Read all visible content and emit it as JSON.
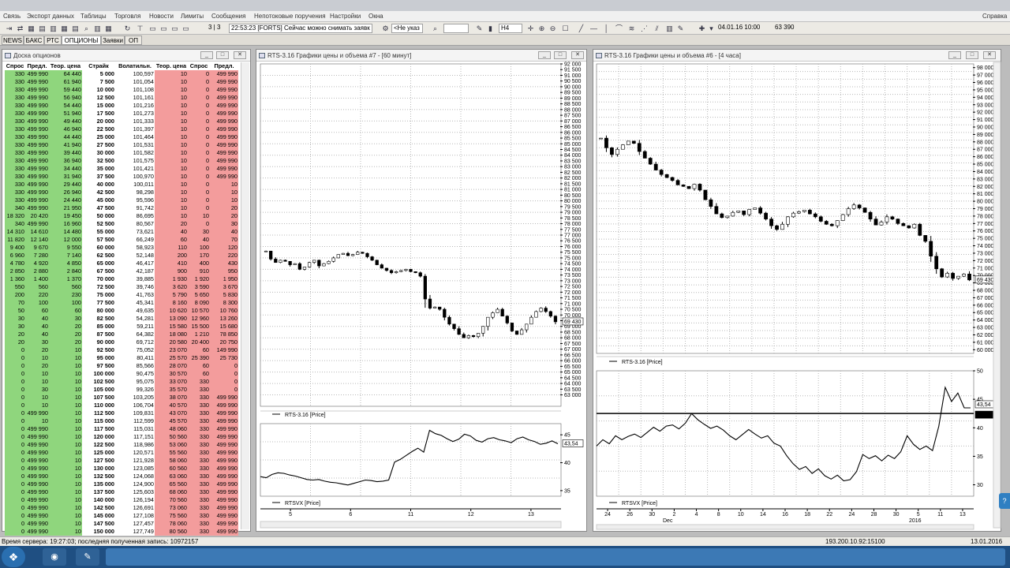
{
  "app": {
    "menu": [
      "Связь",
      "Экспорт данных",
      "Таблицы",
      "Торговля",
      "Новости",
      "Лимиты",
      "Сообщения",
      "Непотоковые поручения",
      "Настройки",
      "Окна"
    ],
    "help_label": "Справка"
  },
  "toolbar": {
    "page_counter": "3 | 3",
    "message": "22:53:23 [FORTS] Сейчас можно снимать заявк",
    "account_select": "<Не указ",
    "search_value": "",
    "interval_select": "H4",
    "date_field": "04.01.16 10:00",
    "price_field": "63 390"
  },
  "tabs": [
    {
      "label": "NEWS",
      "active": false
    },
    {
      "label": "БАКС",
      "active": false
    },
    {
      "label": "РТС",
      "active": false
    },
    {
      "label": "ОПЦИОНЫ",
      "active": true
    },
    {
      "label": "Заявки",
      "active": false
    },
    {
      "label": "ОП",
      "active": false
    }
  ],
  "options_window": {
    "title": "Доска опционов",
    "columns": [
      "Спрос",
      "Предл.",
      "Теор. цена",
      "Страйк",
      "Волатильн.",
      "Теор. цена",
      "Спрос",
      "Предл."
    ],
    "rows": [
      [
        "330",
        "499 990",
        "64 440",
        "5 000",
        "100,597",
        "10",
        "0",
        "499 990"
      ],
      [
        "330",
        "499 990",
        "61 940",
        "7 500",
        "101,054",
        "10",
        "0",
        "499 990"
      ],
      [
        "330",
        "499 990",
        "59 440",
        "10 000",
        "101,108",
        "10",
        "0",
        "499 990"
      ],
      [
        "330",
        "499 990",
        "56 940",
        "12 500",
        "101,161",
        "10",
        "0",
        "499 990"
      ],
      [
        "330",
        "499 990",
        "54 440",
        "15 000",
        "101,216",
        "10",
        "0",
        "499 990"
      ],
      [
        "330",
        "499 990",
        "51 940",
        "17 500",
        "101,273",
        "10",
        "0",
        "499 990"
      ],
      [
        "330",
        "499 990",
        "49 440",
        "20 000",
        "101,333",
        "10",
        "0",
        "499 990"
      ],
      [
        "330",
        "499 990",
        "46 940",
        "22 500",
        "101,397",
        "10",
        "0",
        "499 990"
      ],
      [
        "330",
        "499 990",
        "44 440",
        "25 000",
        "101,464",
        "10",
        "0",
        "499 990"
      ],
      [
        "330",
        "499 990",
        "41 940",
        "27 500",
        "101,531",
        "10",
        "0",
        "499 990"
      ],
      [
        "330",
        "499 990",
        "39 440",
        "30 000",
        "101,582",
        "10",
        "0",
        "499 990"
      ],
      [
        "330",
        "499 990",
        "36 940",
        "32 500",
        "101,575",
        "10",
        "0",
        "499 990"
      ],
      [
        "330",
        "499 990",
        "34 440",
        "35 000",
        "101,421",
        "10",
        "0",
        "499 990"
      ],
      [
        "330",
        "499 990",
        "31 940",
        "37 500",
        "100,970",
        "10",
        "0",
        "499 990"
      ],
      [
        "330",
        "499 990",
        "29 440",
        "40 000",
        "100,011",
        "10",
        "0",
        "10"
      ],
      [
        "330",
        "499 990",
        "26 940",
        "42 500",
        "98,298",
        "10",
        "0",
        "10"
      ],
      [
        "330",
        "499 990",
        "24 440",
        "45 000",
        "95,596",
        "10",
        "0",
        "10"
      ],
      [
        "340",
        "499 990",
        "21 950",
        "47 500",
        "91,742",
        "10",
        "0",
        "20"
      ],
      [
        "18 320",
        "20 420",
        "19 450",
        "50 000",
        "86,695",
        "10",
        "10",
        "20"
      ],
      [
        "340",
        "499 990",
        "16 960",
        "52 500",
        "80,567",
        "20",
        "0",
        "30"
      ],
      [
        "14 310",
        "14 610",
        "14 480",
        "55 000",
        "73,621",
        "40",
        "30",
        "40"
      ],
      [
        "11 820",
        "12 140",
        "12 000",
        "57 500",
        "66,249",
        "60",
        "40",
        "70"
      ],
      [
        "9 400",
        "9 670",
        "9 550",
        "60 000",
        "58,923",
        "110",
        "100",
        "120"
      ],
      [
        "6 960",
        "7 280",
        "7 140",
        "62 500",
        "52,148",
        "200",
        "170",
        "220"
      ],
      [
        "4 780",
        "4 920",
        "4 850",
        "65 000",
        "46,417",
        "410",
        "400",
        "430"
      ],
      [
        "2 850",
        "2 880",
        "2 840",
        "67 500",
        "42,187",
        "900",
        "910",
        "950"
      ],
      [
        "1 360",
        "1 400",
        "1 370",
        "70 000",
        "39,885",
        "1 930",
        "1 920",
        "1 950"
      ],
      [
        "550",
        "560",
        "560",
        "72 500",
        "39,746",
        "3 620",
        "3 590",
        "3 670"
      ],
      [
        "200",
        "220",
        "230",
        "75 000",
        "41,763",
        "5 790",
        "5 650",
        "5 830"
      ],
      [
        "70",
        "100",
        "100",
        "77 500",
        "45,341",
        "8 160",
        "8 090",
        "8 300"
      ],
      [
        "50",
        "60",
        "60",
        "80 000",
        "49,635",
        "10 620",
        "10 570",
        "10 760"
      ],
      [
        "30",
        "40",
        "30",
        "82 500",
        "54,281",
        "13 090",
        "12 960",
        "13 260"
      ],
      [
        "30",
        "40",
        "20",
        "85 000",
        "59,211",
        "15 580",
        "15 500",
        "15 680"
      ],
      [
        "20",
        "40",
        "20",
        "87 500",
        "64,382",
        "18 080",
        "1 210",
        "78 850"
      ],
      [
        "20",
        "30",
        "20",
        "90 000",
        "69,712",
        "20 580",
        "20 400",
        "20 750"
      ],
      [
        "0",
        "20",
        "10",
        "92 500",
        "75,052",
        "23 070",
        "60",
        "149 990"
      ],
      [
        "0",
        "10",
        "10",
        "95 000",
        "80,411",
        "25 570",
        "25 390",
        "25 730"
      ],
      [
        "0",
        "20",
        "10",
        "97 500",
        "85,566",
        "28 070",
        "60",
        "0"
      ],
      [
        "0",
        "10",
        "10",
        "100 000",
        "90,475",
        "30 570",
        "60",
        "0"
      ],
      [
        "0",
        "10",
        "10",
        "102 500",
        "95,075",
        "33 070",
        "330",
        "0"
      ],
      [
        "0",
        "30",
        "10",
        "105 000",
        "99,326",
        "35 570",
        "330",
        "0"
      ],
      [
        "0",
        "10",
        "10",
        "107 500",
        "103,205",
        "38 070",
        "330",
        "499 990"
      ],
      [
        "0",
        "10",
        "10",
        "110 000",
        "106,704",
        "40 570",
        "330",
        "499 990"
      ],
      [
        "0",
        "499 990",
        "10",
        "112 500",
        "109,831",
        "43 070",
        "330",
        "499 990"
      ],
      [
        "0",
        "10",
        "10",
        "115 000",
        "112,599",
        "45 570",
        "330",
        "499 990"
      ],
      [
        "0",
        "499 990",
        "10",
        "117 500",
        "115,031",
        "48 060",
        "330",
        "499 990"
      ],
      [
        "0",
        "499 990",
        "10",
        "120 000",
        "117,151",
        "50 560",
        "330",
        "499 990"
      ],
      [
        "0",
        "499 990",
        "10",
        "122 500",
        "118,986",
        "53 060",
        "330",
        "499 990"
      ],
      [
        "0",
        "499 990",
        "10",
        "125 000",
        "120,571",
        "55 560",
        "330",
        "499 990"
      ],
      [
        "0",
        "499 990",
        "10",
        "127 500",
        "121,928",
        "58 060",
        "330",
        "499 990"
      ],
      [
        "0",
        "499 990",
        "10",
        "130 000",
        "123,085",
        "60 560",
        "330",
        "499 990"
      ],
      [
        "0",
        "499 990",
        "10",
        "132 500",
        "124,068",
        "63 060",
        "330",
        "499 990"
      ],
      [
        "0",
        "499 990",
        "10",
        "135 000",
        "124,900",
        "65 560",
        "330",
        "499 990"
      ],
      [
        "0",
        "499 990",
        "10",
        "137 500",
        "125,603",
        "68 060",
        "330",
        "499 990"
      ],
      [
        "0",
        "499 990",
        "10",
        "140 000",
        "126,194",
        "70 560",
        "330",
        "499 990"
      ],
      [
        "0",
        "499 990",
        "10",
        "142 500",
        "126,691",
        "73 060",
        "330",
        "499 990"
      ],
      [
        "0",
        "499 990",
        "10",
        "145 000",
        "127,108",
        "75 560",
        "330",
        "499 990"
      ],
      [
        "0",
        "499 990",
        "10",
        "147 500",
        "127,457",
        "78 060",
        "330",
        "499 990"
      ],
      [
        "0",
        "499 990",
        "10",
        "150 000",
        "127,749",
        "80 560",
        "330",
        "499 990"
      ]
    ]
  },
  "chart_data": [
    {
      "type": "candlestick",
      "title": "RTS-3.16 Графики цены и объема #7 - [60 минут]",
      "legend": "RTS-3.16 [Price]",
      "ylim": [
        62000,
        92000
      ],
      "yticks": [
        "92 000",
        "91 500",
        "91 000",
        "90 500",
        "90 000",
        "89 500",
        "89 000",
        "88 500",
        "88 000",
        "87 500",
        "87 000",
        "86 500",
        "86 000",
        "85 500",
        "85 000",
        "84 500",
        "84 000",
        "83 500",
        "83 000",
        "82 500",
        "82 000",
        "81 500",
        "81 000",
        "80 500",
        "80 000",
        "79 500",
        "79 000",
        "78 500",
        "78 000",
        "77 500",
        "77 000",
        "76 500",
        "76 000",
        "75 500",
        "75 000",
        "74 500",
        "74 000",
        "73 500",
        "73 000",
        "72 500",
        "72 000",
        "71 500",
        "71 000",
        "70 500",
        "70 000",
        "69 500",
        "69 000",
        "68 500",
        "68 000",
        "67 500",
        "67 000",
        "66 500",
        "66 000",
        "65 500",
        "65 000",
        "64 500",
        "64 000",
        "63 500",
        "63 000"
      ],
      "last_price_label": "69 430",
      "x_ticks": [
        "5",
        "6",
        "11",
        "12",
        "13"
      ],
      "values": [
        75600,
        74900,
        74600,
        74800,
        74700,
        74400,
        74500,
        74000,
        74200,
        74600,
        74800,
        74300,
        74500,
        74700,
        75000,
        75300,
        75400,
        75200,
        75300,
        75500,
        75400,
        75100,
        74800,
        74400,
        74100,
        73900,
        73700,
        73800,
        73900,
        74000,
        73800,
        73700,
        73400,
        71400,
        70600,
        70700,
        70500,
        69800,
        69200,
        68800,
        68300,
        68000,
        68200,
        68100,
        68400,
        69000,
        69800,
        70200,
        70500,
        69900,
        69300,
        68600,
        68300,
        68700,
        69200,
        69800,
        70300,
        70600,
        70300,
        69900,
        69400
      ]
    },
    {
      "type": "line",
      "legend": "RTSVX [Price]",
      "ylim": [
        34,
        47
      ],
      "yticks": [
        "45",
        "40",
        "35"
      ],
      "last_value_label": "43,54",
      "x_ticks": [
        "5",
        "6",
        "11",
        "12",
        "13"
      ],
      "values": [
        37.5,
        37.3,
        37.9,
        38.2,
        38.1,
        37.8,
        37.6,
        37.3,
        37.0,
        36.9,
        37.0,
        36.7,
        36.5,
        36.4,
        36.2,
        36.0,
        36.3,
        36.6,
        36.9,
        36.8,
        36.6,
        36.7,
        36.9,
        40.1,
        40.6,
        41.3,
        42.0,
        42.6,
        41.9,
        45.8,
        45.2,
        44.9,
        44.3,
        43.8,
        44.2,
        45.1,
        44.8,
        44.0,
        43.7,
        44.3,
        44.5,
        44.1,
        43.9,
        43.6,
        44.3,
        44.6,
        44.1,
        43.8,
        43.3,
        43.5,
        43.9,
        43.4
      ]
    },
    {
      "type": "candlestick",
      "title": "RTS-3.16 Графики цены и объема #6 - [4 часа]",
      "legend": "RTS-3.16 [Price]",
      "ylim": [
        59500,
        98500
      ],
      "yticks": [
        "98 000",
        "97 000",
        "96 000",
        "95 000",
        "94 000",
        "93 000",
        "92 000",
        "91 000",
        "90 000",
        "89 000",
        "88 000",
        "87 000",
        "86 000",
        "85 000",
        "84 000",
        "83 000",
        "82 000",
        "81 000",
        "80 000",
        "79 000",
        "78 000",
        "77 000",
        "76 000",
        "75 000",
        "74 000",
        "73 000",
        "72 000",
        "71 000",
        "70 000",
        "69 000",
        "68 000",
        "67 000",
        "66 000",
        "65 000",
        "64 000",
        "63 000",
        "62 000",
        "61 000",
        "60 000"
      ],
      "last_price_label": "69 430",
      "x_ticks": [
        "24",
        "26",
        "30",
        "2",
        "4",
        "8",
        "10",
        "14",
        "16",
        "18",
        "22",
        "24",
        "28",
        "30",
        "5",
        "11",
        "13"
      ],
      "x_sublabels": [
        "Dec",
        "2016"
      ],
      "values": [
        88500,
        87200,
        86300,
        87000,
        87600,
        88100,
        87800,
        86700,
        85800,
        85000,
        84200,
        83600,
        83200,
        82800,
        82200,
        82000,
        81700,
        82300,
        81500,
        80200,
        79300,
        78300,
        77800,
        78000,
        78500,
        78700,
        78200,
        78900,
        79100,
        78400,
        77600,
        76700,
        76200,
        76900,
        77900,
        78400,
        78600,
        78800,
        78300,
        77900,
        77300,
        76900,
        76700,
        77400,
        78200,
        79000,
        79500,
        79100,
        78500,
        77600,
        76800,
        77200,
        77900,
        77600,
        77000,
        76700,
        76400,
        76900,
        75400,
        74600,
        72600,
        70900,
        69800,
        70300,
        69600,
        69900,
        70200,
        69400
      ]
    },
    {
      "type": "line",
      "legend": "RTSVX [Price]",
      "ylim": [
        28,
        50
      ],
      "yticks": [
        "50",
        "45",
        "40",
        "35",
        "30"
      ],
      "last_value_label": "43,54",
      "hline_label": "42,51",
      "hline_value": 42.51,
      "x_ticks": [
        "24",
        "26",
        "30",
        "2",
        "4",
        "8",
        "10",
        "14",
        "16",
        "18",
        "22",
        "24",
        "28",
        "30",
        "5",
        "11",
        "13"
      ],
      "x_sublabels": [
        "Dec",
        "2016"
      ],
      "values": [
        36.8,
        37.9,
        37.2,
        38.6,
        37.9,
        38.5,
        38.9,
        38.3,
        39.2,
        40.1,
        39.4,
        40.3,
        40.5,
        39.8,
        40.8,
        42.5,
        41.4,
        40.6,
        39.9,
        40.3,
        39.6,
        38.6,
        37.9,
        38.8,
        39.7,
        38.9,
        38.2,
        38.6,
        37.3,
        36.8,
        35.1,
        33.7,
        32.7,
        33.2,
        32.0,
        32.8,
        31.6,
        31.0,
        31.7,
        30.7,
        30.9,
        32.3,
        35.3,
        34.6,
        35.1,
        34.2,
        35.2,
        34.6,
        35.8,
        38.6,
        37.1,
        36.2,
        36.8,
        36.0,
        40.3,
        47.1,
        44.6,
        46.1,
        43.5,
        43.5
      ]
    }
  ],
  "status": {
    "server_time": "Время сервера: 19:27:03; последняя полученная запись: 10972157",
    "connection": "193.200.10.92:15100",
    "date": "13.01.2016"
  }
}
